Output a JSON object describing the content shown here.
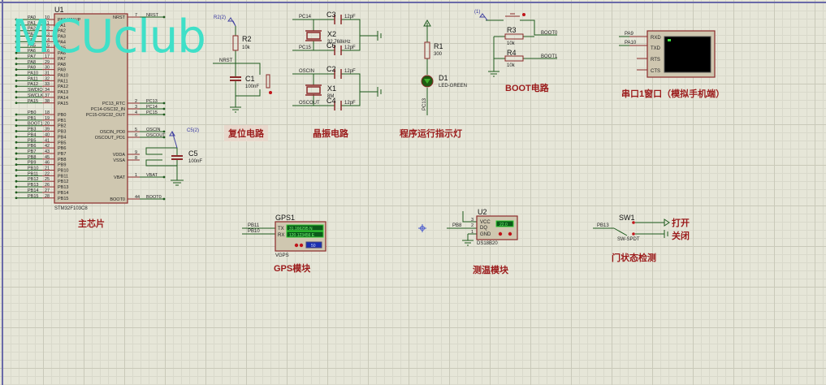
{
  "watermark": "MCUclub",
  "mcu": {
    "ref": "U1",
    "part": "STM32F103C8",
    "pa": [
      [
        "PA0",
        "PA0-WKUP",
        "10"
      ],
      [
        "PA1",
        "PA1",
        "11"
      ],
      [
        "PA2",
        "PA2",
        "12"
      ],
      [
        "PA3",
        "PA3",
        "13"
      ],
      [
        "PA4",
        "PA4",
        "14"
      ],
      [
        "PA5",
        "PA5",
        "15"
      ],
      [
        "PA6",
        "PA6",
        "16"
      ],
      [
        "PA7",
        "PA7",
        "17"
      ],
      [
        "PA8",
        "PA8",
        "29"
      ],
      [
        "PA9",
        "PA9",
        "30"
      ],
      [
        "PA10",
        "PA10",
        "31"
      ],
      [
        "PA11",
        "PA11",
        "32"
      ],
      [
        "PA12",
        "PA12",
        "33"
      ],
      [
        "SWDIO",
        "PA13",
        "34"
      ],
      [
        "SWCLK",
        "PA14",
        "37"
      ],
      [
        "PA15",
        "PA15",
        "38"
      ]
    ],
    "pb": [
      [
        "PB0",
        "PB0",
        "18"
      ],
      [
        "PB1",
        "PB1",
        "19"
      ],
      [
        "BOOT1",
        "PB2",
        "20"
      ],
      [
        "PB3",
        "PB3",
        "39"
      ],
      [
        "PB4",
        "PB4",
        "40"
      ],
      [
        "PB5",
        "PB5",
        "41"
      ],
      [
        "PB6",
        "PB6",
        "42"
      ],
      [
        "PB7",
        "PB7",
        "43"
      ],
      [
        "PB8",
        "PB8",
        "45"
      ],
      [
        "PB9",
        "PB9",
        "46"
      ],
      [
        "PB10",
        "PB10",
        "21"
      ],
      [
        "PB11",
        "PB11",
        "22"
      ],
      [
        "PB12",
        "PB12",
        "25"
      ],
      [
        "PB13",
        "PB13",
        "26"
      ],
      [
        "PB14",
        "PB14",
        "27"
      ],
      [
        "PB15",
        "PB15",
        "28"
      ]
    ],
    "right": [
      [
        "NRST",
        "NRST",
        "7"
      ],
      [
        "PC13",
        "PC13_RTC",
        "2"
      ],
      [
        "PC14",
        "PC14-OSC32_IN",
        "3"
      ],
      [
        "PC15",
        "PC15-OSC32_OUT",
        "4"
      ],
      [
        "OSCIN",
        "OSCIN_PD0",
        "5"
      ],
      [
        "OSCOUT",
        "OSCOUT_PD1",
        "6"
      ],
      [
        "",
        "VDDA",
        "9"
      ],
      [
        "",
        "VSSA",
        "8"
      ],
      [
        "VBAT",
        "VBAT",
        "1"
      ],
      [
        "BOOT0",
        "BOOT0",
        "44"
      ]
    ],
    "c5": {
      "ref": "C5",
      "value": "100nF",
      "probe": "C5(2)"
    },
    "caption": "主芯片"
  },
  "reset": {
    "probe": "R2(2)",
    "r": "R2",
    "rv": "10k",
    "net": "NRST",
    "c": "C1",
    "cv": "100nF",
    "caption": "复位电路"
  },
  "crystal": {
    "n1": "PC14",
    "n2": "PC15",
    "n3": "OSCIN",
    "n4": "OSCOUT",
    "c3": "C3",
    "c6": "C6",
    "c2": "C2",
    "c4": "C4",
    "cv": "12pF",
    "x2": "X2",
    "x2v": "32.768kHz",
    "x1": "X1",
    "x1v": "8M",
    "caption": "晶振电路"
  },
  "led": {
    "r": "R1",
    "rv": "300",
    "d": "D1",
    "dv": "LED-GREEN",
    "net": "PC13",
    "caption": "程序运行指示灯",
    "color": "#2e7d1a"
  },
  "boot": {
    "probe": "(1)",
    "r3": "R3",
    "r4": "R4",
    "rv": "10k",
    "n0": "BOOT0",
    "n1": "BOOT1",
    "caption": "BOOT电路"
  },
  "uart": {
    "rxd": "RXD",
    "txd": "TXD",
    "rts": "RTS",
    "cts": "CTS",
    "n1": "PA9",
    "n2": "PA10",
    "caption": "串口1窗口（模拟手机端）"
  },
  "gps": {
    "ref": "GPS1",
    "part": "VGPS",
    "tx": "TX",
    "rx": "RX",
    "lat": "31.166295 N",
    "lon": "120.123456 E",
    "baud": "50",
    "n1": "PB11",
    "n2": "PB10",
    "caption": "GPS模块"
  },
  "temp": {
    "ref": "U2",
    "part": "DS18B20",
    "vcc": "VCC",
    "dq": "DQ",
    "gnd": "GND",
    "reading": "22.0",
    "net": "PB8",
    "p3": "3",
    "p2": "2",
    "p1": "1",
    "caption": "测温模块"
  },
  "door": {
    "ref": "SW1",
    "part": "SW-SPDT",
    "net": "PB13",
    "open": "打开",
    "close": "关闭",
    "caption": "门状态检测"
  }
}
